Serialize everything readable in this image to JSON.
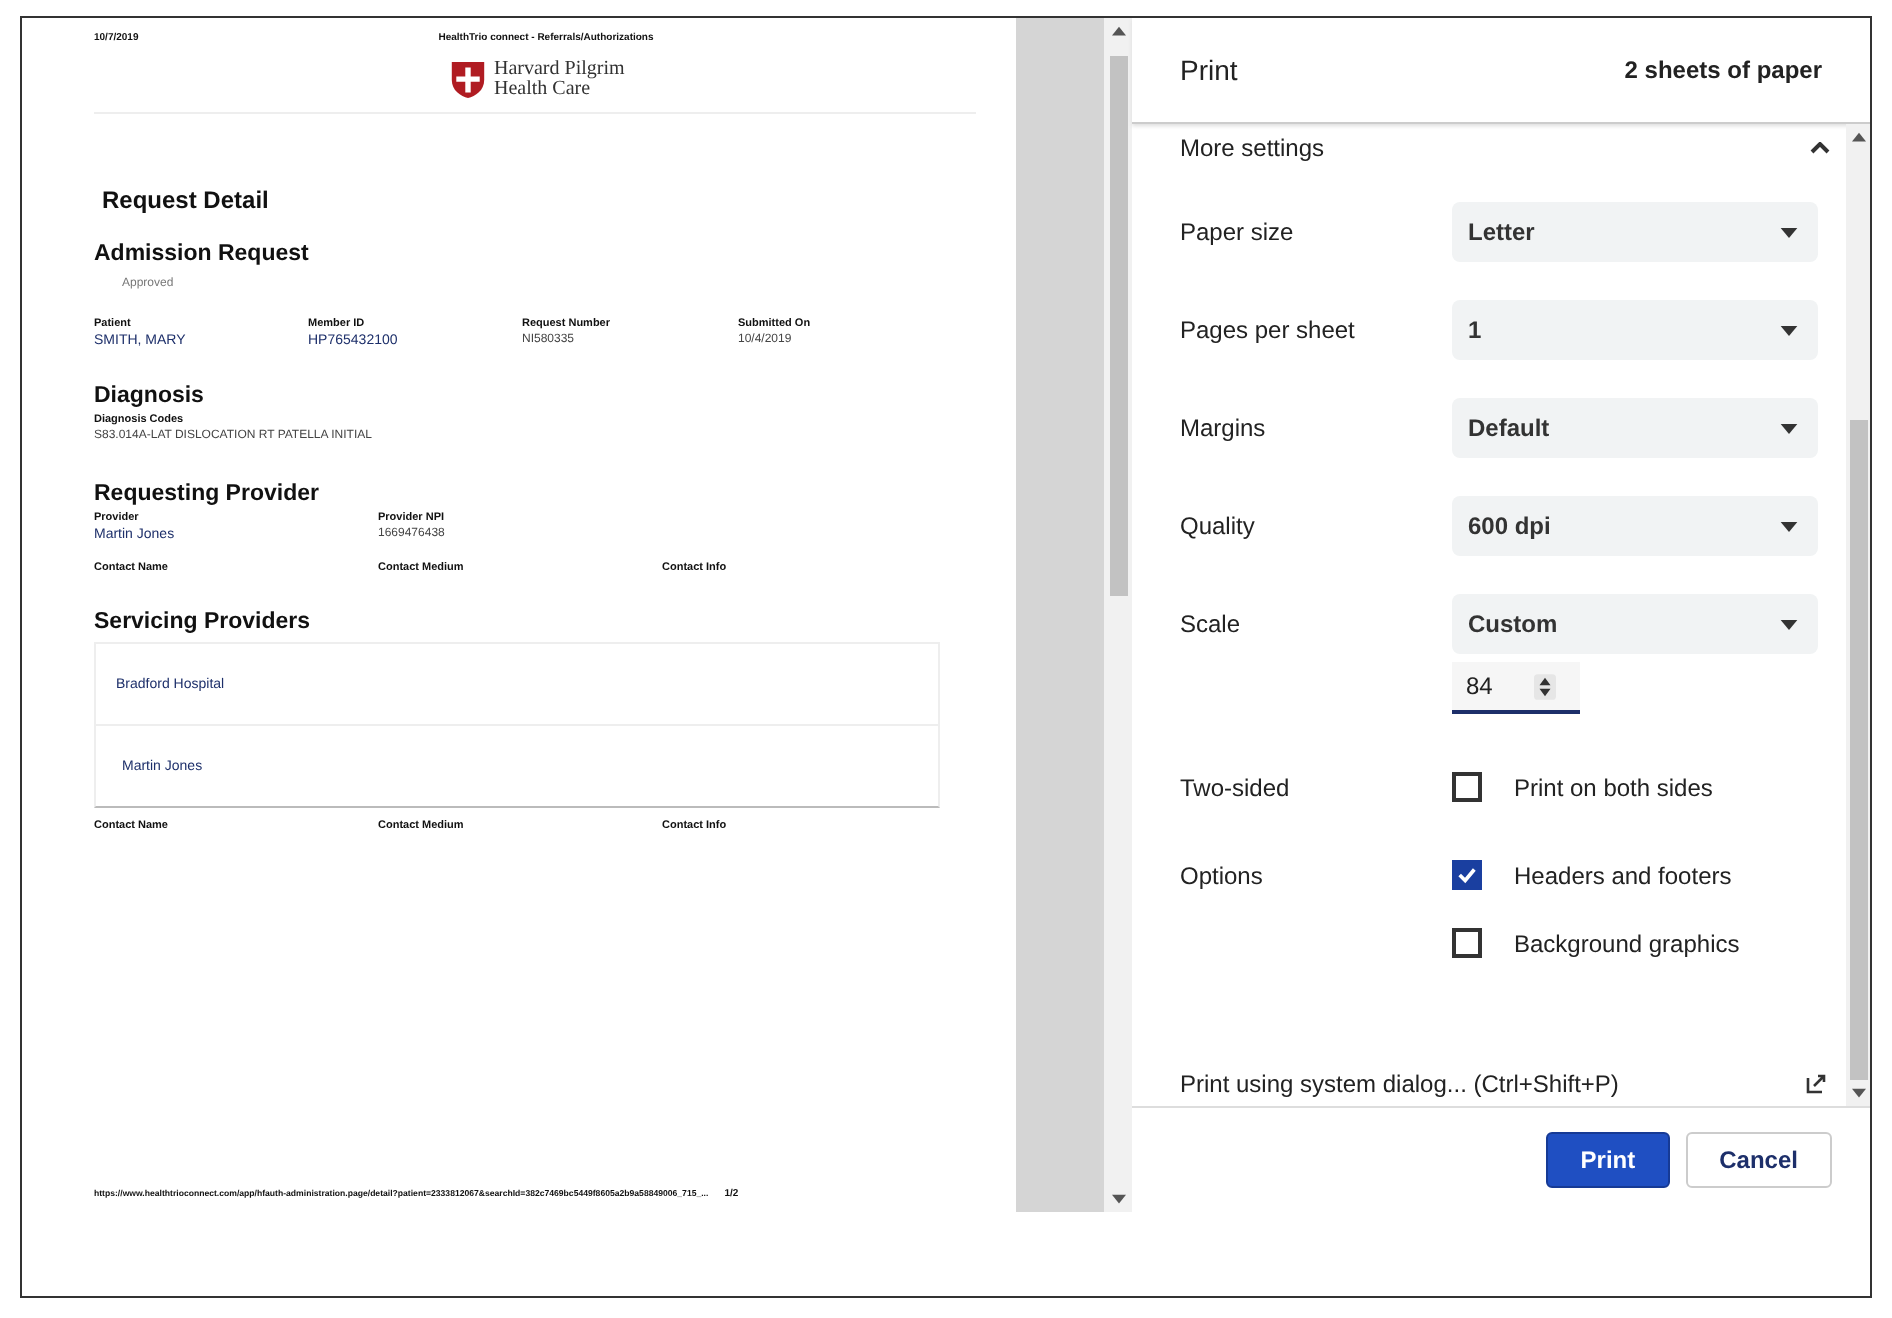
{
  "preview": {
    "page_header": {
      "date": "10/7/2019",
      "title": "HealthTrio connect - Referrals/Authorizations"
    },
    "logo": {
      "line1": "Harvard Pilgrim",
      "line2": "Health Care"
    },
    "title": "Request Detail",
    "admission": {
      "heading": "Admission Request",
      "status": "Approved",
      "fields": [
        {
          "label": "Patient",
          "value": "SMITH, MARY",
          "link": true
        },
        {
          "label": "Member ID",
          "value": "HP765432100",
          "link": true
        },
        {
          "label": "Request Number",
          "value": "NI580335",
          "link": false
        },
        {
          "label": "Submitted On",
          "value": "10/4/2019",
          "link": false
        }
      ]
    },
    "diagnosis": {
      "heading": "Diagnosis",
      "label": "Diagnosis Codes",
      "value": "S83.014A-LAT DISLOCATION RT PATELLA INITIAL"
    },
    "requesting": {
      "heading": "Requesting Provider",
      "fields": [
        {
          "label": "Provider",
          "value": "Martin Jones",
          "link": true
        },
        {
          "label": "Provider NPI",
          "value": "1669476438",
          "link": false
        }
      ],
      "contact_columns": [
        "Contact Name",
        "Contact Medium",
        "Contact Info"
      ]
    },
    "servicing": {
      "heading": "Servicing Providers",
      "providers": [
        "Bradford Hospital",
        "Martin Jones"
      ],
      "contact_columns": [
        "Contact Name",
        "Contact Medium",
        "Contact Info"
      ]
    },
    "footer": {
      "url": "https://www.healthtrioconnect.com/app/hfauth-administration.page/detail?patient=2333812067&searchId=382c7469bc5449f8605a2b9a58849006_715_...",
      "page": "1/2"
    }
  },
  "print": {
    "title": "Print",
    "sheets": "2 sheets of paper",
    "more_settings": {
      "label": "More settings",
      "expanded": true
    },
    "settings": [
      {
        "kind": "select",
        "label": "Paper size",
        "value": "Letter"
      },
      {
        "kind": "select",
        "label": "Pages per sheet",
        "value": "1"
      },
      {
        "kind": "select",
        "label": "Margins",
        "value": "Default"
      },
      {
        "kind": "select",
        "label": "Quality",
        "value": "600 dpi"
      },
      {
        "kind": "select",
        "label": "Scale",
        "value": "Custom"
      },
      {
        "kind": "number",
        "value": "84"
      },
      {
        "kind": "checkbox",
        "label": "Two-sided",
        "option": "Print on both sides",
        "checked": false
      },
      {
        "kind": "checkbox",
        "label": "Options",
        "option": "Headers and footers",
        "checked": true
      },
      {
        "kind": "checkbox",
        "option": "Background graphics",
        "checked": false
      }
    ],
    "system_dialog": "Print using system dialog... (Ctrl+Shift+P)",
    "buttons": [
      {
        "label": "Print",
        "kind": "primary"
      },
      {
        "label": "Cancel",
        "kind": "secondary"
      }
    ]
  }
}
